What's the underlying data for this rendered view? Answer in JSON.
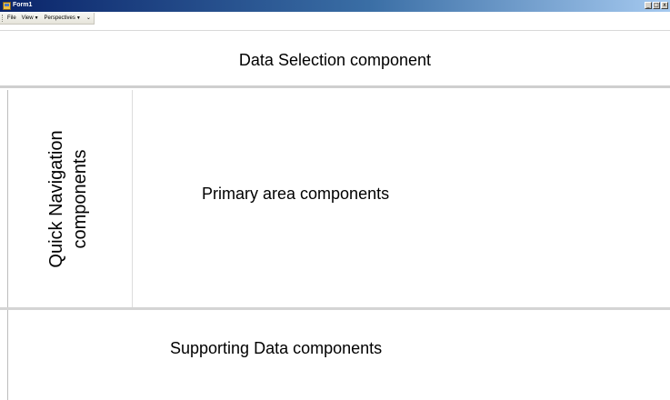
{
  "window": {
    "title": "Form1",
    "minimize_glyph": "_",
    "maximize_glyph": "□",
    "close_glyph": "x"
  },
  "menu": {
    "items": [
      {
        "label": "File",
        "has_dropdown": false
      },
      {
        "label": "View",
        "has_dropdown": true,
        "arrow": "▼"
      },
      {
        "label": "Perspectives",
        "has_dropdown": true,
        "arrow": "▼"
      }
    ],
    "overflow_glyph": "⌄"
  },
  "panels": {
    "data_selection": {
      "label": "Data Selection component"
    },
    "quick_navigation": {
      "label_line1": "Quick Navigation",
      "label_line2": "components"
    },
    "primary_area": {
      "label": "Primary area components"
    },
    "supporting_data": {
      "label": "Supporting Data components"
    }
  },
  "colors": {
    "titlebar_start": "#0a246a",
    "titlebar_end": "#a6caf0",
    "panel_background": "#ffffff",
    "separator": "#cfcfcf"
  }
}
